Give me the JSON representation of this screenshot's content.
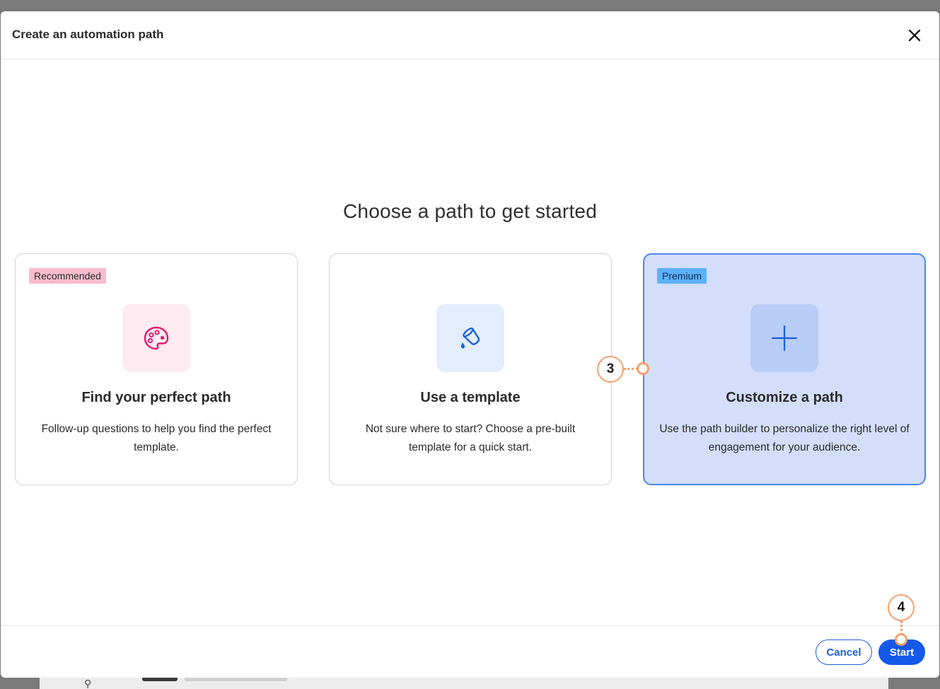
{
  "modal": {
    "title": "Create an automation path",
    "close_icon": "close-icon"
  },
  "main": {
    "heading": "Choose a path to get started",
    "cards": [
      {
        "badge": "Recommended",
        "icon": "palette-icon",
        "title": "Find your perfect path",
        "description": "Follow-up questions to help you find the perfect template."
      },
      {
        "badge": "",
        "icon": "paint-bucket-icon",
        "title": "Use a template",
        "description": "Not sure where to start? Choose a pre-built template for a quick start."
      },
      {
        "badge": "Premium",
        "icon": "plus-icon",
        "title": "Customize a path",
        "description": "Use the path builder to personalize the right level of engagement for your audience.",
        "selected": true
      }
    ]
  },
  "footer": {
    "cancel_label": "Cancel",
    "start_label": "Start"
  },
  "callouts": {
    "step3": "3",
    "step4": "4"
  },
  "colors": {
    "accent": "#1459e8",
    "selected_card": "#d3defa",
    "callout": "#f4a06a",
    "recommended_badge": "#f8bccd",
    "premium_badge": "#5cb1f7"
  }
}
